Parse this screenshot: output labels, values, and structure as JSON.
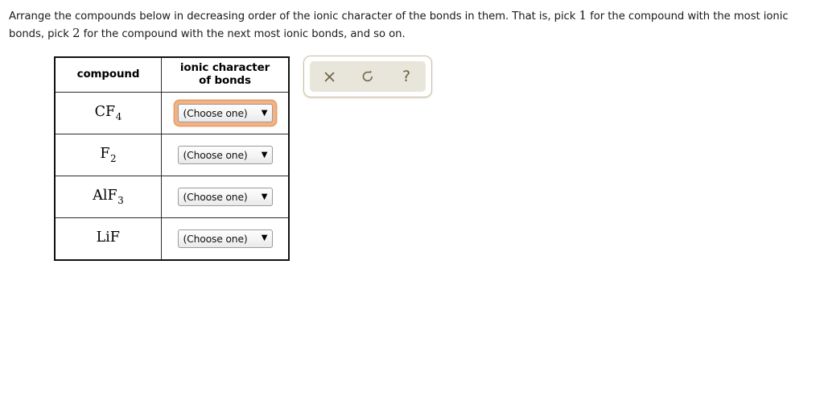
{
  "instructions": {
    "part1": "Arrange the compounds below in decreasing order of the ionic character of the bonds in them. That is, pick ",
    "num1": "1",
    "part2": " for the compound with the most ionic bonds, pick ",
    "num2": "2",
    "part3": " for the compound with the next most ionic bonds, and so on."
  },
  "table": {
    "headers": {
      "compound": "compound",
      "ionic_line1": "ionic character",
      "ionic_line2": "of bonds"
    },
    "rows": [
      {
        "formula_base": "CF",
        "formula_sub": "4",
        "select_value": "(Choose one)",
        "caret": "▼",
        "focused": true
      },
      {
        "formula_base": "F",
        "formula_sub": "2",
        "select_value": "(Choose one)",
        "caret": "▼",
        "focused": false
      },
      {
        "formula_base": "AlF",
        "formula_sub": "3",
        "select_value": "(Choose one)",
        "caret": "▼",
        "focused": false
      },
      {
        "formula_base": "LiF",
        "formula_sub": "",
        "select_value": "(Choose one)",
        "caret": "▼",
        "focused": false
      }
    ]
  },
  "toolbar": {
    "buttons": [
      {
        "icon": "close-icon",
        "label": "×",
        "name": "clear-button"
      },
      {
        "icon": "undo-icon",
        "label": "↺",
        "name": "undo-button"
      },
      {
        "icon": "help-icon",
        "label": "?",
        "name": "help-button"
      }
    ]
  },
  "colors": {
    "focus_ring": "#f4b183",
    "tool_icon": "#6b6243",
    "tool_strip_bg": "#e8e5da",
    "tool_panel_border": "#c9bfa6",
    "table_border": "#111111"
  }
}
